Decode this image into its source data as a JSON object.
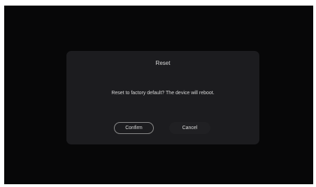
{
  "dialog": {
    "title": "Reset",
    "message": "Reset to factory default? The device will reboot.",
    "confirm_label": "Confirm",
    "cancel_label": "Cancel"
  },
  "colors": {
    "background": "#070708",
    "dialog_bg": "#1c1c1f",
    "confirm_border": "#8a8a8a",
    "text": "#dcdcdc"
  }
}
